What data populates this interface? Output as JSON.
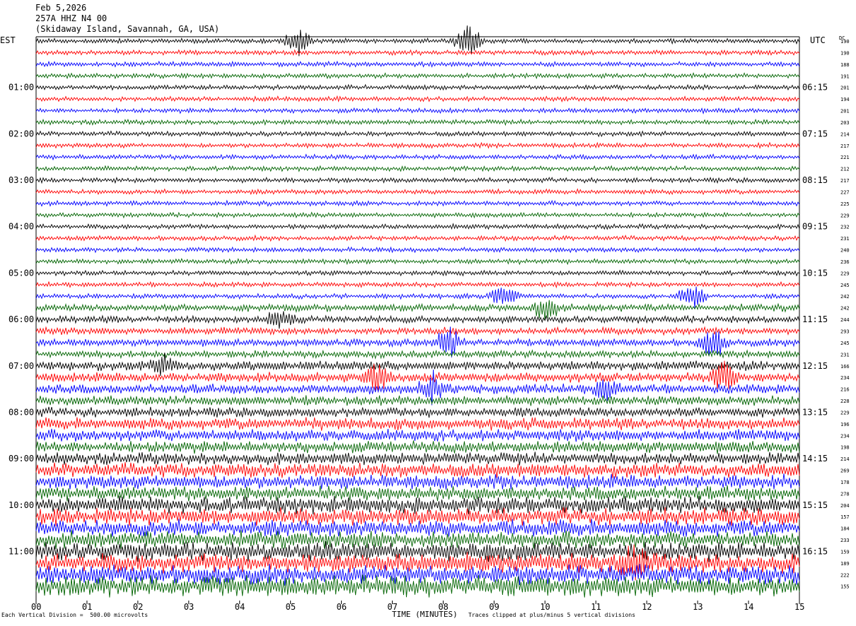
{
  "header": {
    "date": "Feb 5,2026",
    "station": "257A HHZ N4 00",
    "location": "(Skidaway Island, Savannah, GA, USA)"
  },
  "footer": {
    "scale": "Each Vertical Division =  500.00 microvolts",
    "xlabel": "TIME (MINUTES)",
    "clip_note": "Traces clipped at plus/minus 5 vertical divisions"
  },
  "chart_data": {
    "type": "line",
    "title": "",
    "left_axis_label": "EST",
    "right_axis_label": "UTC",
    "dc_label": "DC",
    "xlabel": "TIME (MINUTES)",
    "xlim": [
      0,
      15
    ],
    "x_ticks": [
      "00",
      "01",
      "02",
      "03",
      "04",
      "05",
      "06",
      "07",
      "08",
      "09",
      "10",
      "11",
      "12",
      "13",
      "14",
      "15"
    ],
    "left_hour_labels": [
      "01:00",
      "02:00",
      "03:00",
      "04:00",
      "05:00",
      "06:00",
      "07:00",
      "08:00",
      "09:00",
      "10:00",
      "11:00"
    ],
    "right_hour_labels": [
      "06:15",
      "07:15",
      "08:15",
      "09:15",
      "10:15",
      "11:15",
      "12:15",
      "13:15",
      "14:15",
      "15:15",
      "16:15"
    ],
    "trace_colors": [
      "#000000",
      "#ff0000",
      "#0000ff",
      "#006400"
    ],
    "minutes_per_trace": 15,
    "dc_offsets": [
      190,
      190,
      188,
      191,
      201,
      194,
      201,
      203,
      214,
      217,
      221,
      212,
      217,
      227,
      225,
      229,
      232,
      231,
      240,
      236,
      229,
      245,
      242,
      242,
      244,
      293,
      245,
      231,
      166,
      234,
      216,
      228,
      229,
      196,
      234,
      198,
      214,
      269,
      178,
      278,
      204,
      157,
      184,
      233,
      159,
      189,
      222,
      155
    ],
    "trace_amplitude_level": [
      2,
      2,
      2,
      2,
      2,
      2,
      2,
      2,
      2,
      2,
      2,
      2,
      2,
      2,
      2,
      2,
      2,
      2,
      2,
      2,
      2,
      2,
      2,
      3,
      3,
      3,
      3,
      3,
      4,
      4,
      4,
      4,
      4,
      5,
      5,
      5,
      5,
      6,
      6,
      6,
      7,
      7,
      7,
      7,
      8,
      8,
      8,
      9
    ],
    "events": [
      {
        "trace": 0,
        "minute": 5.15,
        "strength": 3
      },
      {
        "trace": 0,
        "minute": 8.5,
        "strength": 3
      },
      {
        "trace": 22,
        "minute": 9.2,
        "strength": 2
      },
      {
        "trace": 22,
        "minute": 12.9,
        "strength": 2.5
      },
      {
        "trace": 23,
        "minute": 10.0,
        "strength": 2.5
      },
      {
        "trace": 24,
        "minute": 4.8,
        "strength": 2
      },
      {
        "trace": 26,
        "minute": 8.1,
        "strength": 3
      },
      {
        "trace": 26,
        "minute": 13.3,
        "strength": 3
      },
      {
        "trace": 28,
        "minute": 2.5,
        "strength": 2
      },
      {
        "trace": 29,
        "minute": 6.7,
        "strength": 2.5
      },
      {
        "trace": 29,
        "minute": 13.5,
        "strength": 3
      },
      {
        "trace": 30,
        "minute": 7.8,
        "strength": 3
      },
      {
        "trace": 30,
        "minute": 11.2,
        "strength": 2
      },
      {
        "trace": 45,
        "minute": 11.8,
        "strength": 3
      }
    ]
  }
}
